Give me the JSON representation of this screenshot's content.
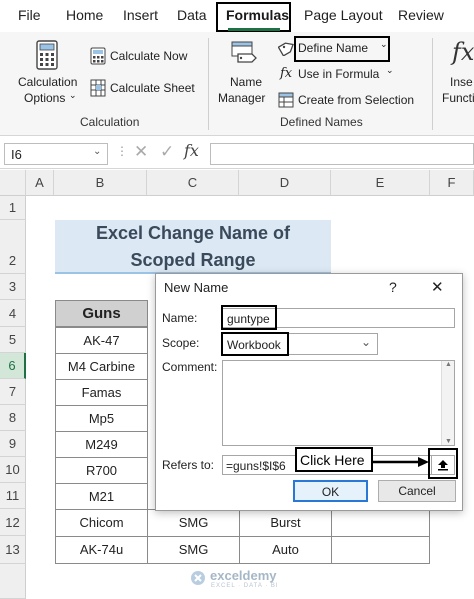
{
  "menu": {
    "tabs": [
      "File",
      "Home",
      "Insert",
      "Data",
      "Formulas",
      "Page Layout",
      "Review"
    ],
    "active": "Formulas"
  },
  "ribbon": {
    "calc_options_line1": "Calculation",
    "calc_options_line2": "Options",
    "calculate_now": "Calculate Now",
    "calculate_sheet": "Calculate Sheet",
    "calculation_group": "Calculation",
    "name_manager_line1": "Name",
    "name_manager_line2": "Manager",
    "define_name": "Define Name",
    "use_in_formula": "Use in Formula",
    "create_from_selection": "Create from Selection",
    "defined_names_group": "Defined Names",
    "insert_fn_line1": "Inse",
    "insert_fn_line2": "Functi",
    "fx_glyph": "fx"
  },
  "formula_bar": {
    "name_box": "I6",
    "fx": "fx",
    "content": ""
  },
  "sheet": {
    "columns": [
      "A",
      "B",
      "C",
      "D",
      "E",
      "F"
    ],
    "rows": [
      "1",
      "2",
      "3",
      "4",
      "5",
      "6",
      "7",
      "8",
      "9",
      "10",
      "11",
      "12",
      "13"
    ],
    "title_line1": "Excel Change Name of",
    "title_line2": "Scoped Range",
    "header_guns": "Guns",
    "guns": [
      "AK-47",
      "M4 Carbine",
      "Famas",
      "Mp5",
      "M249",
      "R700",
      "M21",
      "Chicom",
      "AK-74u"
    ],
    "row12": [
      "SMG",
      "Burst"
    ],
    "row13": [
      "SMG",
      "Auto"
    ]
  },
  "dialog": {
    "title": "New Name",
    "help": "?",
    "close": "✕",
    "name_label": "Name:",
    "name_value": "guntype",
    "scope_label": "Scope:",
    "scope_value": "Workbook",
    "comment_label": "Comment:",
    "refers_label": "Refers to:",
    "refers_value": "=guns!$I$6",
    "ok": "OK",
    "cancel": "Cancel",
    "callout": "Click Here"
  },
  "watermark": {
    "brand": "exceldemy",
    "tagline": "EXCEL · DATA · BI"
  },
  "colors": {
    "accent_green": "#1e7145",
    "title_fill": "#dce9f5",
    "title_text": "#3a4a5a",
    "header_fill": "#d0d0d0"
  }
}
